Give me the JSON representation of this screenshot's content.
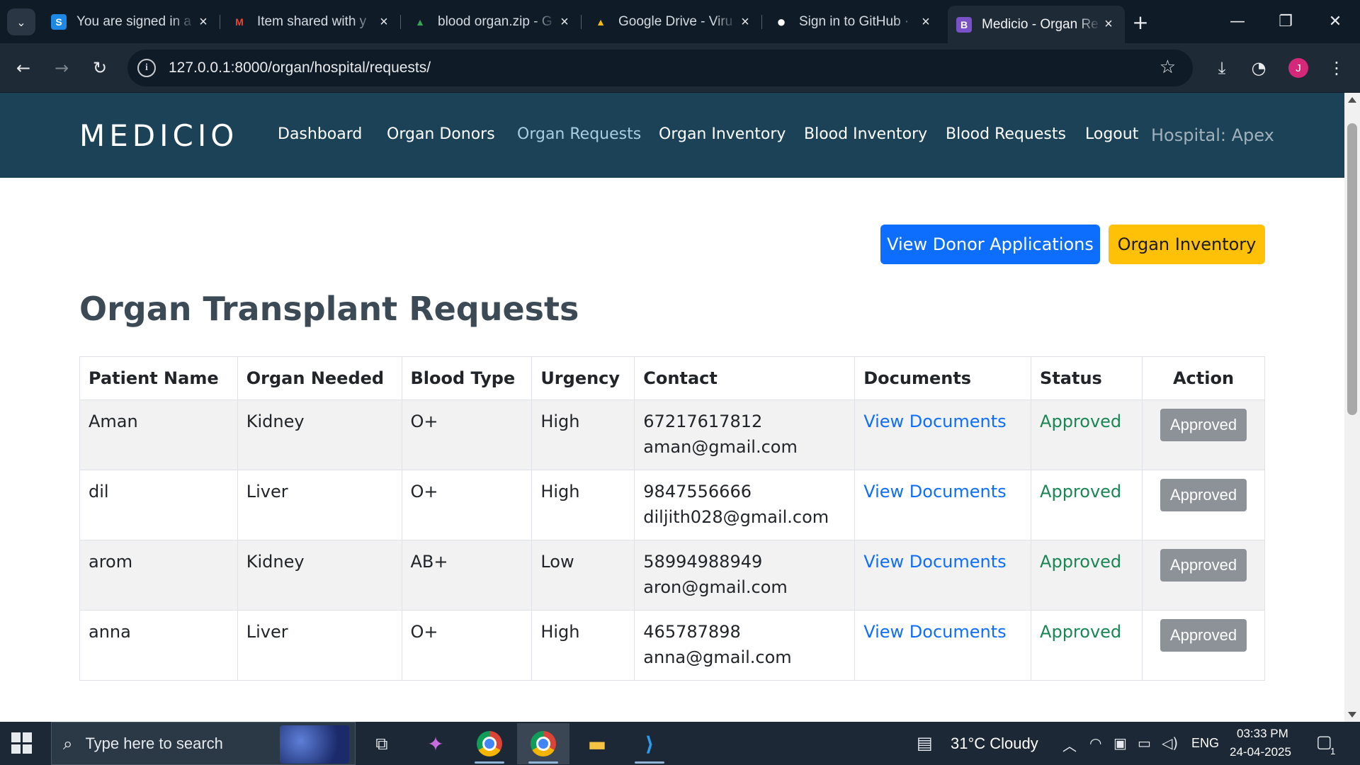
{
  "browser": {
    "tabs": [
      {
        "title": "You are signed in a",
        "favicon": "S"
      },
      {
        "title": "Item shared with y",
        "favicon": "M"
      },
      {
        "title": "blood organ.zip - G",
        "favicon": "▲"
      },
      {
        "title": "Google Drive - Viru",
        "favicon": "▲"
      },
      {
        "title": "Sign in to GitHub ·",
        "favicon": "●"
      },
      {
        "title": "Medicio - Organ Re",
        "favicon": "B"
      }
    ],
    "url": "127.0.0.1:8000/organ/hospital/requests/",
    "profile_initial": "J"
  },
  "header": {
    "logo": "MEDICIO",
    "nav": [
      {
        "label": "Dashboard"
      },
      {
        "label": "Organ Donors"
      },
      {
        "label": "Organ Requests"
      },
      {
        "label": "Organ Inventory"
      },
      {
        "label": "Blood Inventory"
      },
      {
        "label": "Blood Requests"
      },
      {
        "label": "Logout"
      }
    ],
    "hospital_label": "Hospital: Apex"
  },
  "actions": {
    "view_donor_applications": "View Donor Applications",
    "organ_inventory": "Organ Inventory"
  },
  "page": {
    "title": "Organ Transplant Requests"
  },
  "table": {
    "columns": [
      "Patient Name",
      "Organ Needed",
      "Blood Type",
      "Urgency",
      "Contact",
      "Documents",
      "Status",
      "Action"
    ],
    "rows": [
      {
        "patient": "Aman",
        "organ": "Kidney",
        "blood": "O+",
        "urgency": "High",
        "phone": "67217617812",
        "email": "aman@gmail.com",
        "documents": "View Documents",
        "status": "Approved",
        "action": "Approved"
      },
      {
        "patient": "dil",
        "organ": "Liver",
        "blood": "O+",
        "urgency": "High",
        "phone": "9847556666",
        "email": "diljith028@gmail.com",
        "documents": "View Documents",
        "status": "Approved",
        "action": "Approved"
      },
      {
        "patient": "arom",
        "organ": "Kidney",
        "blood": "AB+",
        "urgency": "Low",
        "phone": "58994988949",
        "email": "aron@gmail.com",
        "documents": "View Documents",
        "status": "Approved",
        "action": "Approved"
      },
      {
        "patient": "anna",
        "organ": "Liver",
        "blood": "O+",
        "urgency": "High",
        "phone": "465787898",
        "email": "anna@gmail.com",
        "documents": "View Documents",
        "status": "Approved",
        "action": "Approved"
      }
    ]
  },
  "taskbar": {
    "search_placeholder": "Type here to search",
    "weather": "31°C  Cloudy",
    "language": "ENG",
    "time": "03:33 PM",
    "date": "24-04-2025",
    "notification_count": "1"
  },
  "colors": {
    "header_bg": "#1b4257",
    "primary": "#0d6efd",
    "warning": "#ffc107",
    "approved_text": "#198754",
    "approved_button": "#8c9297"
  }
}
